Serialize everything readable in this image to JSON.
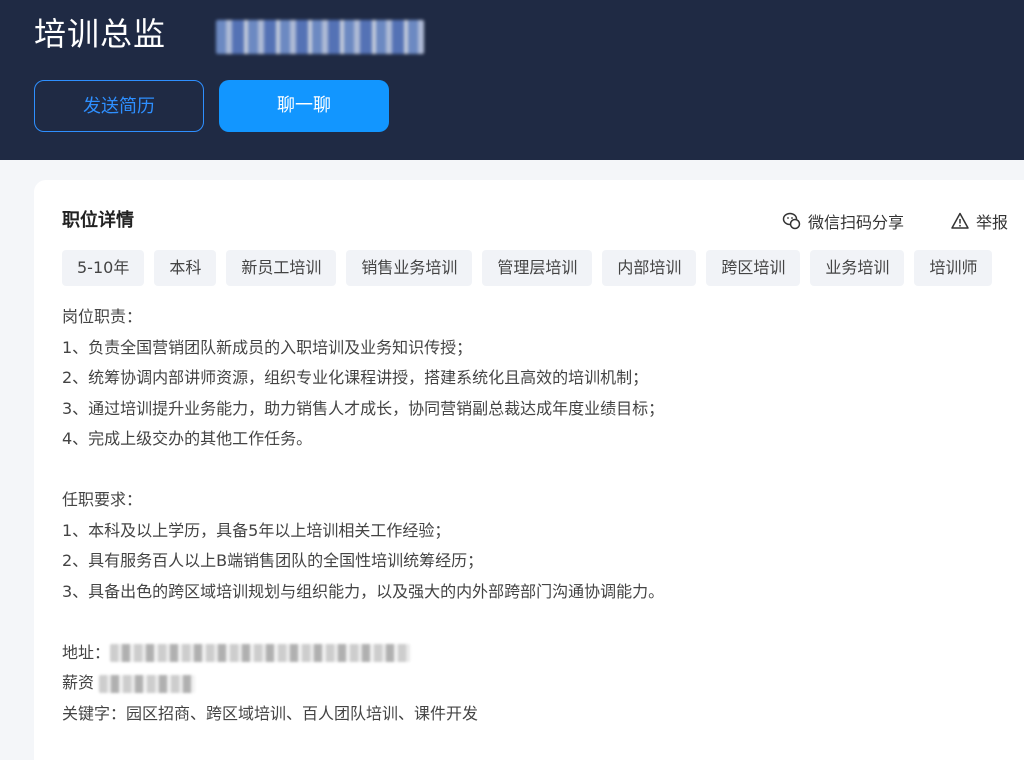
{
  "header": {
    "job_title": "培训总监",
    "send_resume_label": "发送简历",
    "chat_label": "聊一聊"
  },
  "detail": {
    "section_title": "职位详情",
    "share_label": "微信扫码分享",
    "report_label": "举报",
    "tags": [
      "5-10年",
      "本科",
      "新员工培训",
      "销售业务培训",
      "管理层培训",
      "内部培训",
      "跨区培训",
      "业务培训",
      "培训师"
    ],
    "responsibilities_heading": "岗位职责：",
    "responsibilities": [
      "1、负责全国营销团队新成员的入职培训及业务知识传授；",
      "2、统筹协调内部讲师资源，组织专业化课程讲授，搭建系统化且高效的培训机制；",
      "3、通过培训提升业务能力，助力销售人才成长，协同营销副总裁达成年度业绩目标；",
      "4、完成上级交办的其他工作任务。"
    ],
    "requirements_heading": "任职要求：",
    "requirements": [
      "1、本科及以上学历，具备5年以上培训相关工作经验；",
      "2、具有服务百人以上B端销售团队的全国性培训统筹经历；",
      "3、具备出色的跨区域培训规划与组织能力，以及强大的内外部跨部门沟通协调能力。"
    ],
    "address_label": "地址：",
    "salary_label": "薪资",
    "keywords_line": "关键字：园区招商、跨区域培训、百人团队培训、课件开发"
  },
  "colors": {
    "header_bg": "#1f2a44",
    "accent": "#1296ff",
    "tag_bg": "#f1f3f7"
  }
}
